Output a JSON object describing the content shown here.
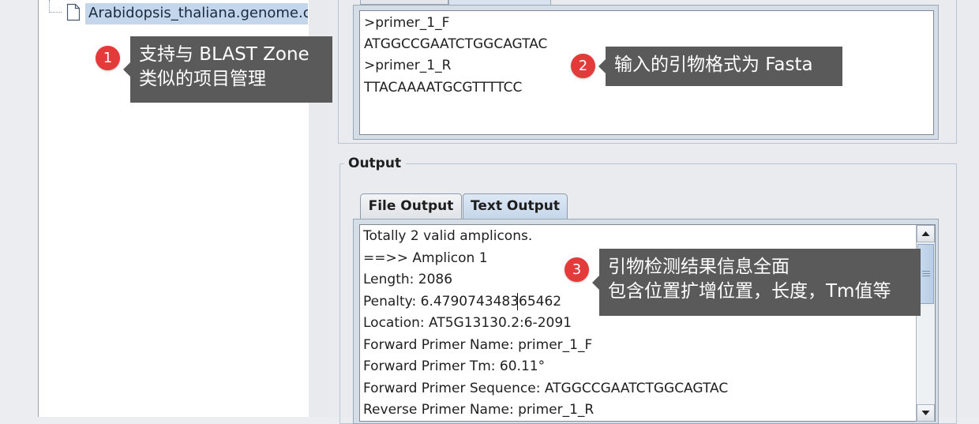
{
  "tree": {
    "item_label": "Arabidopsis_thaliana.genome.cds.fa"
  },
  "input": {
    "lines": [
      ">primer_1_F",
      "ATGGCCGAATCTGGCAGTAC",
      ">primer_1_R",
      "TTACAAAATGCGTTTTCC"
    ]
  },
  "output": {
    "group_title": "Output",
    "tabs": [
      {
        "label": "File Output"
      },
      {
        "label": "Text Output"
      }
    ],
    "lines": [
      "Totally 2  valid amplicons.",
      "==>> Amplicon 1",
      "Length: 2086",
      "Penalty: 6.479074348365462",
      "Location: AT5G13130.2:6-2091",
      "Forward Primer Name: primer_1_F",
      "Forward Primer Tm: 60.11°",
      "Forward Primer Sequence: ATGGCCGAATCTGGCAGTAC",
      "Reverse Primer Name: primer_1_R"
    ]
  },
  "callouts": [
    {
      "number": "1",
      "lines": [
        "支持与 BLAST Zone",
        "类似的项目管理"
      ]
    },
    {
      "number": "2",
      "lines": [
        "输入的引物格式为 Fasta"
      ]
    },
    {
      "number": "3",
      "lines": [
        "引物检测结果信息全面",
        "包含位置扩增位置，长度，Tm值等"
      ]
    }
  ],
  "colors": {
    "badge": "#e53a3a",
    "callout_bg": "#5a5a5a",
    "selection": "#c4d6ec"
  }
}
